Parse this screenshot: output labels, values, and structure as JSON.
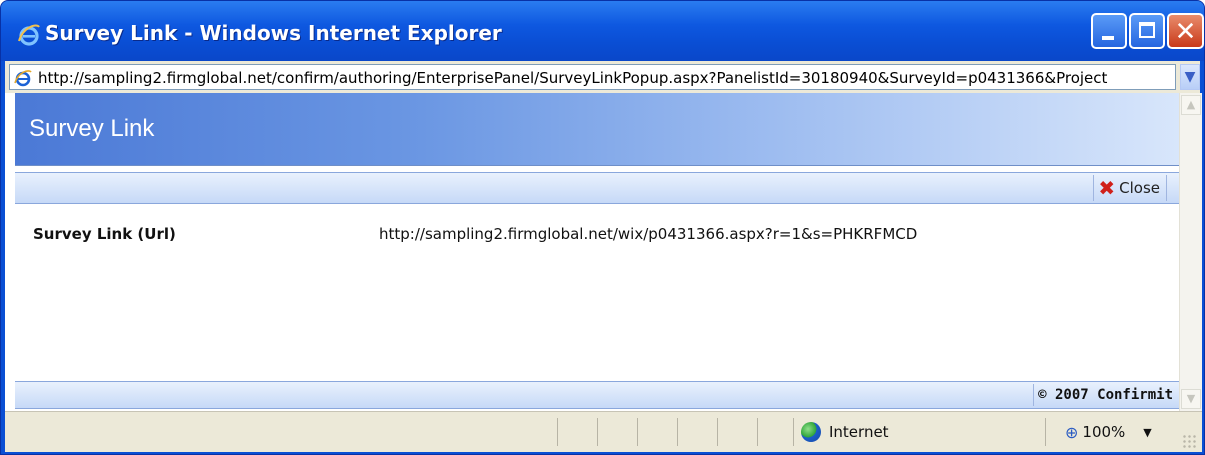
{
  "window": {
    "title": "Survey Link - Windows Internet Explorer"
  },
  "address_bar": {
    "url": "http://sampling2.firmglobal.net/confirm/authoring/EnterprisePanel/SurveyLinkPopup.aspx?PanelistId=30180940&SurveyId=p0431366&Project"
  },
  "page": {
    "header_title": "Survey Link",
    "toolbar": {
      "close_label": "Close"
    },
    "field": {
      "label": "Survey Link (Url)",
      "value": "http://sampling2.firmglobal.net/wix/p0431366.aspx?r=1&s=PHKRFMCD"
    },
    "footer": {
      "copyright": "© 2007 Confirmit"
    }
  },
  "status_bar": {
    "zone": "Internet",
    "zoom": "100%"
  },
  "colors": {
    "titlebar": "#0a4ed4",
    "header_gradient_start": "#4b79d6",
    "close_icon": "#d0201a"
  }
}
